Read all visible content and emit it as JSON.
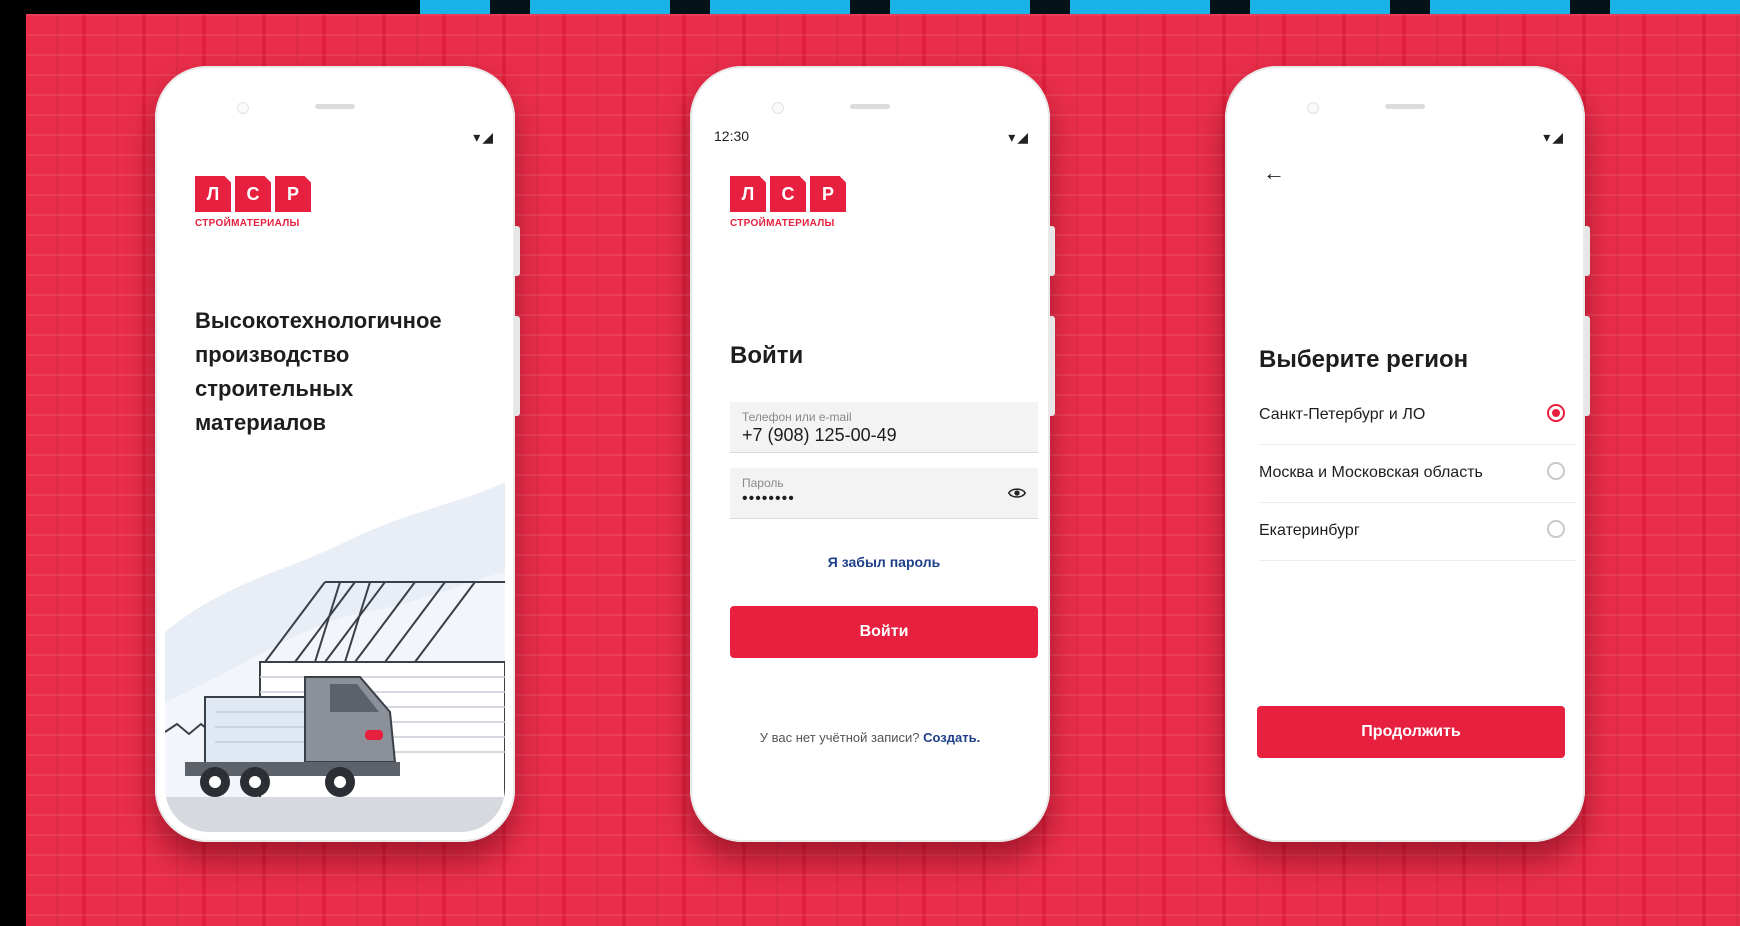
{
  "colors": {
    "brand_red": "#e8203f",
    "link_blue": "#1f3f8a",
    "background": "#e8203f"
  },
  "icons": {
    "wifi_signal": "▾◢",
    "back_arrow": "←",
    "eye": "eye-icon"
  },
  "logo": {
    "letters": [
      "Л",
      "С",
      "Р"
    ],
    "subtitle": "СТРОЙМАТЕРИАЛЫ"
  },
  "screen1": {
    "headline": [
      "Высокотехнологичное",
      "производство",
      "строительных",
      "материалов"
    ]
  },
  "screen2": {
    "time": "12:30",
    "title": "Войти",
    "phone_label": "Телефон или e-mail",
    "phone_value": "+7 (908) 125-00-49",
    "password_label": "Пароль",
    "password_value": "••••••••",
    "forgot_label": "Я забыл пароль",
    "login_button": "Войти",
    "no_account_text": "У вас нет учётной записи?",
    "create_link": "Создать."
  },
  "screen3": {
    "title": "Выберите регион",
    "regions": [
      {
        "name": "Санкт-Петербург и ЛО",
        "selected": true
      },
      {
        "name": "Москва и Московская область",
        "selected": false
      },
      {
        "name": "Екатеринбург",
        "selected": false
      }
    ],
    "continue_button": "Продолжить"
  }
}
